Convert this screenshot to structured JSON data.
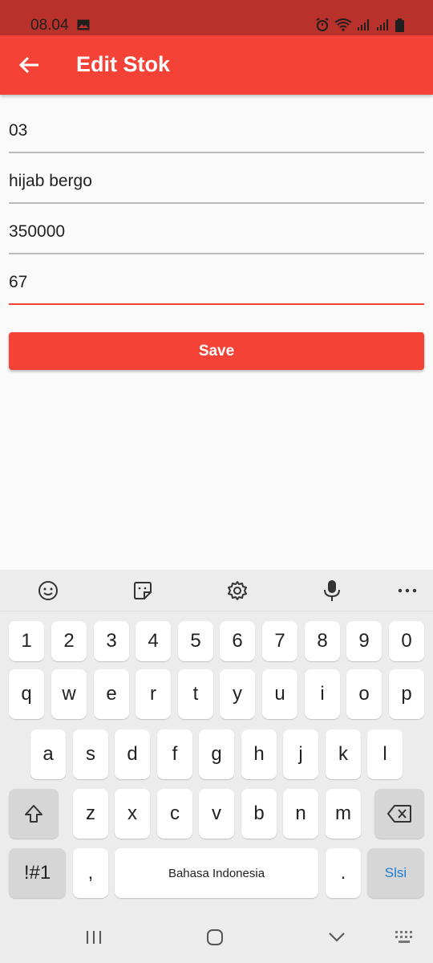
{
  "status_bar": {
    "time": "08.04"
  },
  "app_bar": {
    "title": "Edit Stok"
  },
  "form": {
    "fields": [
      {
        "value": "03"
      },
      {
        "value": "hijab bergo"
      },
      {
        "value": "350000"
      },
      {
        "value": "67"
      }
    ],
    "save_label": "Save"
  },
  "keyboard": {
    "row_numbers": [
      "1",
      "2",
      "3",
      "4",
      "5",
      "6",
      "7",
      "8",
      "9",
      "0"
    ],
    "row_q": [
      "q",
      "w",
      "e",
      "r",
      "t",
      "y",
      "u",
      "i",
      "o",
      "p"
    ],
    "row_a": [
      "a",
      "s",
      "d",
      "f",
      "g",
      "h",
      "j",
      "k",
      "l"
    ],
    "row_z": [
      "z",
      "x",
      "c",
      "v",
      "b",
      "n",
      "m"
    ],
    "symbols_label": "!#1",
    "comma_label": ",",
    "space_label": "Bahasa Indonesia",
    "period_label": ".",
    "action_label": "Slsi"
  },
  "colors": {
    "accent": "#f44336",
    "status_bar": "#b8312b",
    "keyboard_action": "#1e7bd6"
  }
}
